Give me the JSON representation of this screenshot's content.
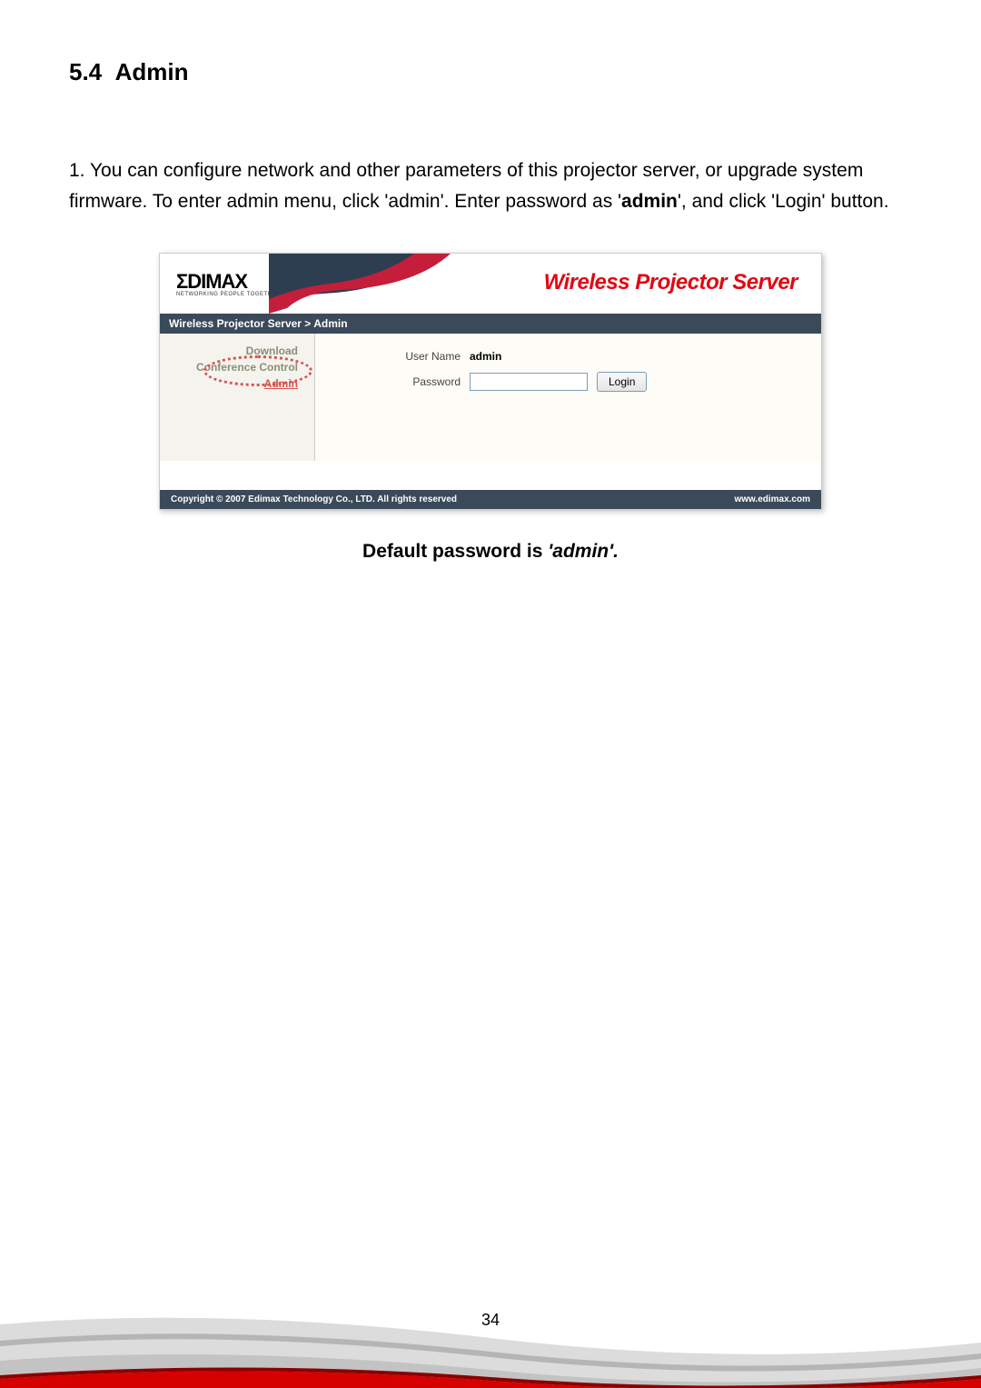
{
  "section": {
    "number": "5.4",
    "title": "Admin"
  },
  "paragraph": {
    "prefix": "1. You can configure network and other parameters of this projector server, or upgrade system firmware. To enter admin menu, click 'admin'. Enter password as '",
    "bold": "admin",
    "suffix": "', and click 'Login' button."
  },
  "screenshot": {
    "logo_main": "ΣDIMAX",
    "logo_sub": "NETWORKING PEOPLE TOGETHER",
    "header_title": "Wireless Projector Server",
    "breadcrumb": "Wireless Projector Server > Admin",
    "sidebar": {
      "items": [
        {
          "label": "Download",
          "active": false
        },
        {
          "label": "Conference Control",
          "active": false
        },
        {
          "label": "Admin",
          "active": true
        }
      ]
    },
    "form": {
      "username_label": "User Name",
      "username_value": "admin",
      "password_label": "Password",
      "password_value": "",
      "login_label": "Login"
    },
    "footer_left": "Copyright © 2007 Edimax Technology Co., LTD. All rights reserved",
    "footer_right": "www.edimax.com"
  },
  "caption": {
    "lead": "Default password is ",
    "value": "'admin'."
  },
  "page_number": "34"
}
